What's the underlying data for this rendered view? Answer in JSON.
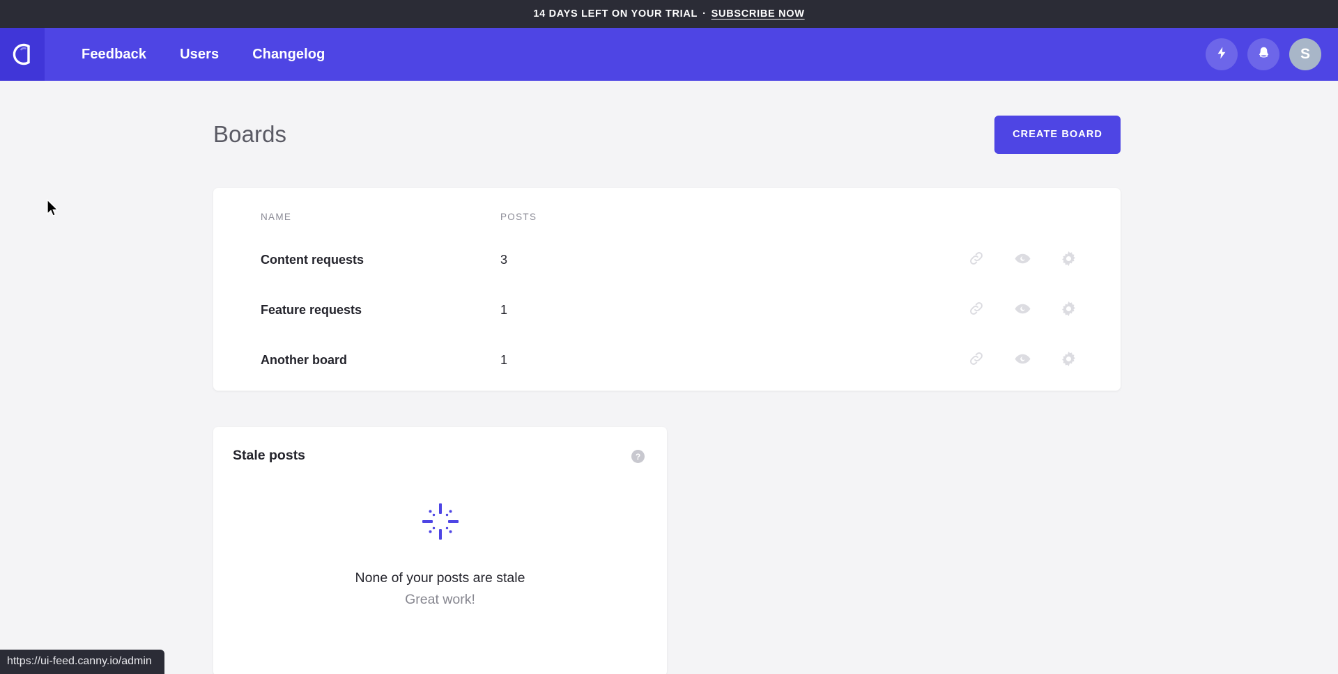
{
  "banner": {
    "text": "14 DAYS LEFT ON YOUR TRIAL",
    "separator": "·",
    "link_label": "SUBSCRIBE NOW"
  },
  "nav": {
    "logo_icon": "canny-c-logo-icon",
    "links": [
      {
        "label": "Feedback"
      },
      {
        "label": "Users"
      },
      {
        "label": "Changelog"
      }
    ],
    "actions": [
      {
        "icon": "lightning-bolt-icon"
      },
      {
        "icon": "bell-icon"
      }
    ],
    "avatar_initial": "S"
  },
  "page": {
    "title": "Boards",
    "create_button": "CREATE BOARD"
  },
  "boards": {
    "columns": [
      "NAME",
      "POSTS"
    ],
    "rows": [
      {
        "name": "Content requests",
        "posts": "3"
      },
      {
        "name": "Feature requests",
        "posts": "1"
      },
      {
        "name": "Another board",
        "posts": "1"
      }
    ],
    "row_actions": [
      "link-icon",
      "eye-icon",
      "gear-icon"
    ]
  },
  "stale_posts": {
    "title": "Stale posts",
    "help_icon_label": "?",
    "empty_icon": "burst-sparkle-icon",
    "empty_message": "None of your posts are stale",
    "empty_submessage": "Great work!"
  },
  "status_bar": {
    "url": "https://ui-feed.canny.io/admin"
  },
  "colors": {
    "brand_blue": "#4e45e4",
    "logo_blue": "#4036d8",
    "banner_dark": "#2b2c36",
    "page_background": "#f4f4f6",
    "avatar_gray": "#a8b6c8"
  }
}
